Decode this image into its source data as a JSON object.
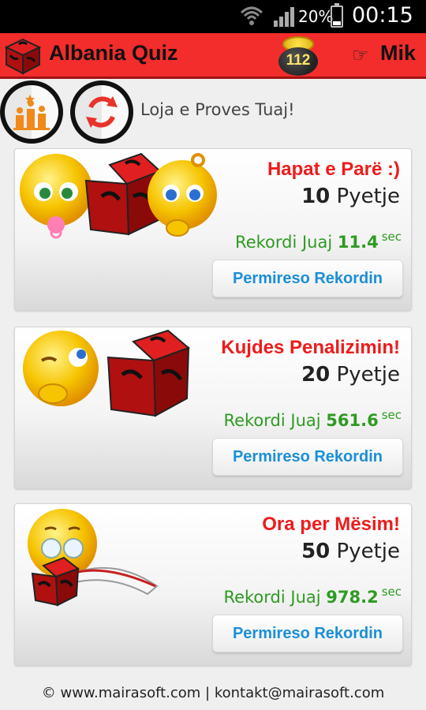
{
  "status_bar": {
    "battery_percent": "20%",
    "time": "00:15",
    "icons": [
      "wifi-icon",
      "signal-icon",
      "battery-icon"
    ]
  },
  "app_bar": {
    "title": "Albania Quiz",
    "coins": "112",
    "user_name": "Mik",
    "icons": [
      "dice-logo-icon",
      "coin-pot-icon",
      "pointing-hand-icon"
    ]
  },
  "actions": {
    "trial_text": "Loja e Proves Tuaj!",
    "icons": [
      "stats-podium-icon",
      "refresh-icon"
    ]
  },
  "levels": [
    {
      "title": "Hapat e Parë :)",
      "question_count": "10",
      "questions_label": "Pyetje",
      "record_label": "Rekordi Juaj",
      "record_value": "11.4",
      "record_unit": "sec",
      "button_label": "Permireso Rekordin"
    },
    {
      "title": "Kujdes Penalizimin!",
      "question_count": "20",
      "questions_label": "Pyetje",
      "record_label": "Rekordi Juaj",
      "record_value": "561.6",
      "record_unit": "sec",
      "button_label": "Permireso Rekordin"
    },
    {
      "title": "Ora per Mësim!",
      "question_count": "50",
      "questions_label": "Pyetje",
      "record_label": "Rekordi Juaj",
      "record_value": "978.2",
      "record_unit": "sec",
      "button_label": "Permireso Rekordin"
    }
  ],
  "footer": {
    "text": "© www.mairasoft.com | kontakt@mairasoft.com"
  },
  "colors": {
    "app_bar": "#f32c2c",
    "title_red": "#ee1b1b",
    "record_green": "#2e9b22",
    "button_blue": "#1c8fd6",
    "coin_gold": "#ffe46b"
  }
}
